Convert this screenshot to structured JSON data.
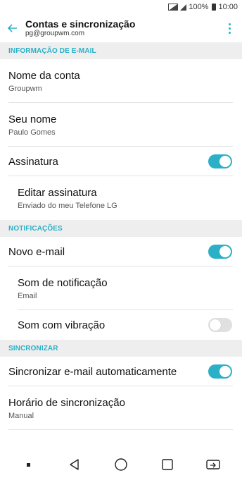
{
  "status_bar": {
    "battery": "100%",
    "time": "10:00"
  },
  "header": {
    "title": "Contas e sincronização",
    "subtitle": "pg@groupwm.com"
  },
  "sections": {
    "email_info": "INFORMAÇÃO DE E-MAIL",
    "notifications": "NOTIFICAÇÕES",
    "sync": "SINCRONIZAR"
  },
  "items": {
    "account_name": {
      "label": "Nome da conta",
      "value": "Groupwm"
    },
    "your_name": {
      "label": "Seu nome",
      "value": "Paulo Gomes"
    },
    "signature": {
      "label": "Assinatura",
      "enabled": true
    },
    "edit_signature": {
      "label": "Editar assinatura",
      "value": "Enviado do meu Telefone LG"
    },
    "new_email": {
      "label": "Novo e-mail",
      "enabled": true
    },
    "notification_sound": {
      "label": "Som de notificação",
      "value": "Email"
    },
    "vibration_sound": {
      "label": "Som com vibração",
      "enabled": false
    },
    "auto_sync": {
      "label": "Sincronizar e-mail automaticamente",
      "enabled": true
    },
    "sync_schedule": {
      "label": "Horário de sincronização",
      "value": "Manual"
    }
  },
  "colors": {
    "accent": "#2bb0c7",
    "section_bg": "#eeeeee"
  },
  "icons": [
    "back-arrow-icon",
    "more-vert-icon",
    "nav-back-icon",
    "nav-home-icon",
    "nav-recents-icon",
    "nav-dual-window-icon"
  ]
}
